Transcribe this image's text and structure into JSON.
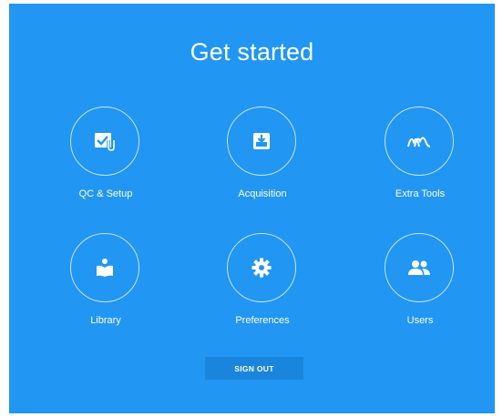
{
  "page": {
    "title": "Get started",
    "background_color": "#2196f3",
    "accent_color": "#ffffff"
  },
  "tiles": [
    {
      "label": "QC & Setup",
      "icon": "qc-setup-icon"
    },
    {
      "label": "Acquisition",
      "icon": "acquisition-tray-icon"
    },
    {
      "label": "Extra Tools",
      "icon": "extra-tools-waves-icon"
    },
    {
      "label": "Library",
      "icon": "library-reader-icon"
    },
    {
      "label": "Preferences",
      "icon": "gear-icon"
    },
    {
      "label": "Users",
      "icon": "users-icon"
    }
  ],
  "sign_out": {
    "label": "SIGN OUT"
  }
}
